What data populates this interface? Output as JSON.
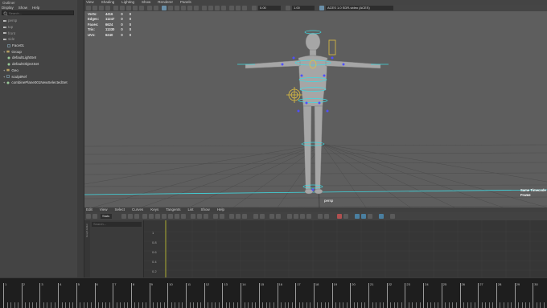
{
  "outliner": {
    "title": "Outliner",
    "menus": [
      "Display",
      "Show",
      "Help"
    ],
    "search_placeholder": "Search...",
    "items": [
      "persp",
      "top",
      "front",
      "side",
      "Face01",
      "Group",
      "defaultLightSet",
      "defaultObjectSet",
      "Geo",
      "sculptRef",
      "combinePlane001NewSelectedSet"
    ]
  },
  "viewport": {
    "menus": [
      "View",
      "Shading",
      "Lighting",
      "Show",
      "Renderer",
      "Panels"
    ],
    "field1": "0.00",
    "field2": "1.00",
    "colorspace": "ACES 1.0 SDR-video (ACES)",
    "hud": {
      "rows": [
        {
          "label": "Verts:",
          "v1": "4416",
          "v2": "0",
          "v3": "0"
        },
        {
          "label": "Edges:",
          "v1": "11247",
          "v2": "0",
          "v3": "0"
        },
        {
          "label": "Faces:",
          "v1": "6624",
          "v2": "0",
          "v3": "0"
        },
        {
          "label": "Tris:",
          "v1": "11330",
          "v2": "0",
          "v3": "0"
        },
        {
          "label": "UVs:",
          "v1": "6240",
          "v2": "0",
          "v3": "0"
        }
      ]
    },
    "camera_label": "persp",
    "corner_labels": [
      "Same Timecode",
      "Frame"
    ]
  },
  "graph_editor": {
    "menus": [
      "Edit",
      "View",
      "Select",
      "Curves",
      "Keys",
      "Tangents",
      "List",
      "Show",
      "Help"
    ],
    "stats_field": "Stats",
    "search_placeholder": "Search...",
    "y_ticks": [
      "1",
      "0.8",
      "0.6",
      "0.4",
      "0.2",
      "0"
    ],
    "side_label": "Graph Editor"
  },
  "timeline": {
    "ticks": [
      "1",
      "2",
      "3",
      "4",
      "5",
      "6",
      "7",
      "8",
      "9",
      "10",
      "11",
      "12",
      "13",
      "14",
      "15",
      "16",
      "17",
      "18",
      "19",
      "20",
      "21",
      "22",
      "23",
      "24",
      "25",
      "26",
      "27",
      "28",
      "29",
      "30"
    ]
  },
  "colors": {
    "accent_cyan": "#40d8e0",
    "viewport_bg": "#5e5e5e",
    "control_blue": "#5050ff",
    "control_yellow": "#e0c040"
  }
}
